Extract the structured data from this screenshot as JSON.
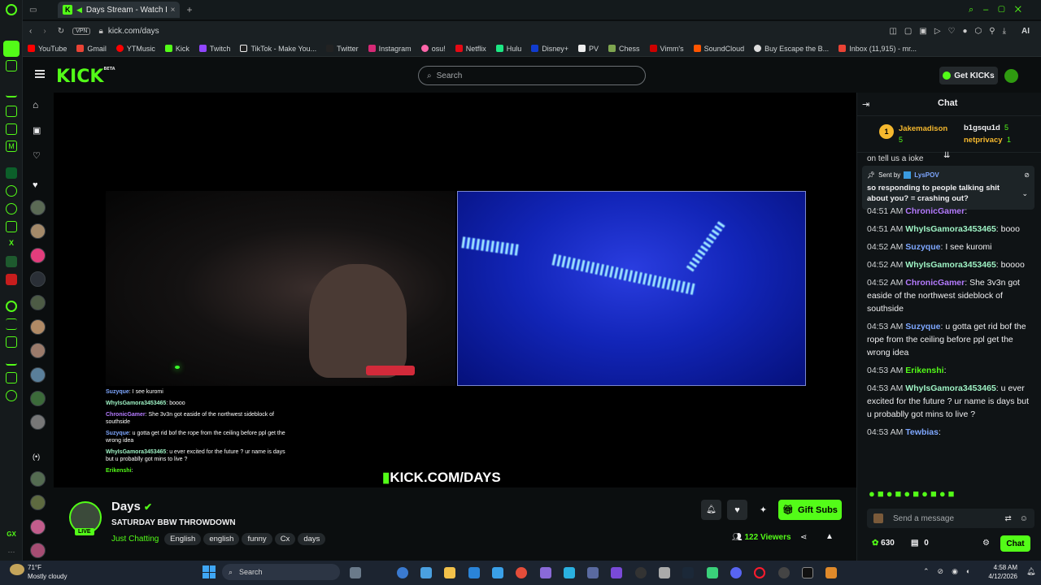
{
  "browser": {
    "tab_title": "Days Stream - Watch L",
    "url": "kick.com/days",
    "vpn_label": "VPN",
    "ai_label": "AI",
    "bookmarks": [
      "YouTube",
      "Gmail",
      "YTMusic",
      "Kick",
      "Twitch",
      "TikTok - Make You...",
      "Twitter",
      "Instagram",
      "osu!",
      "Netflix",
      "Hulu",
      "Disney+",
      "PV",
      "Chess",
      "Vimm's",
      "SoundCloud",
      "Buy Escape the B...",
      "Inbox (11,915) - mr..."
    ]
  },
  "kick": {
    "logo": "KICK",
    "beta": "BETA",
    "search_placeholder": "Search",
    "get_kicks_label": "Get KICKs"
  },
  "video": {
    "watermark": "KICK.COM/DAYS",
    "overlay_chat": [
      {
        "user": "Suzyque",
        "text": ": I see kuromi"
      },
      {
        "user": "WhyIsGamora3453465",
        "text": ": boooo"
      },
      {
        "user": "ChronicGamer",
        "text": ": She 3v3n got easide of the northwest sideblock of southside"
      },
      {
        "user": "Suzyque",
        "text": ": u gotta get rid bof the rope from the ceiling before ppl get the wrong idea"
      },
      {
        "user": "WhyIsGamora3453465",
        "text": ": u ever excited for the future ? ur name is days but u probablly got mins to live ?"
      },
      {
        "user": "Erikenshi",
        "text": ":"
      }
    ]
  },
  "stream": {
    "channel_name": "Days",
    "live_badge": "LIVE",
    "title": "SATURDAY BBW THROWDOWN",
    "category": "Just Chatting",
    "tags": [
      "English",
      "english",
      "funny",
      "Cx",
      "days"
    ],
    "viewers": "122",
    "viewers_label": "Viewers",
    "gift_subs_label": "Gift Subs"
  },
  "chat": {
    "header": "Chat",
    "top_gifters": [
      {
        "rank": "1",
        "name": "Jakemadison",
        "count": "5"
      },
      {
        "name": "b1gsqu1d",
        "count": "5"
      },
      {
        "name": "netprivacy",
        "count": "1"
      }
    ],
    "partial_line": "on tell us a joke",
    "pinned": {
      "sent_by": "Sent by",
      "user": "LysPOV",
      "text": "so responding to people talking shit about you? = crashing out?"
    },
    "messages": [
      {
        "time": "04:51 AM",
        "user": "ChronicGamer",
        "text": ":",
        "color": "#b57bff"
      },
      {
        "time": "04:51 AM",
        "user": "WhyIsGamora3453465",
        "text": ": booo",
        "color": "#9ef2c4"
      },
      {
        "time": "04:52 AM",
        "user": "Suzyque",
        "text": ": I see kuromi",
        "color": "#7ea7ff"
      },
      {
        "time": "04:52 AM",
        "user": "WhyIsGamora3453465",
        "text": ": boooo",
        "color": "#9ef2c4"
      },
      {
        "time": "04:52 AM",
        "user": "ChronicGamer",
        "text": ": She 3v3n got easide of the northwest sideblock of southside",
        "color": "#b57bff"
      },
      {
        "time": "04:53 AM",
        "user": "Suzyque",
        "text": ": u gotta get rid bof the rope from the ceiling before ppl get the wrong idea",
        "color": "#7ea7ff"
      },
      {
        "time": "04:53 AM",
        "user": "Erikenshi",
        "text": ":",
        "color": "#53fc18"
      },
      {
        "time": "04:53 AM",
        "user": "WhyIsGamora3453465",
        "text": ": u ever excited for the future ? ur name is days but u probablly got mins to live ?",
        "color": "#9ef2c4"
      },
      {
        "time": "04:53 AM",
        "user": "Tewbias",
        "text": ":",
        "color": "#7ea7ff"
      }
    ],
    "input_placeholder": "Send a message",
    "points": "630",
    "zero_count": "0",
    "chat_button": "Chat"
  },
  "taskbar": {
    "weather_temp": "71°F",
    "weather_desc": "Mostly cloudy",
    "search_label": "Search",
    "time": "4:58 AM",
    "date": "4/12/2026"
  },
  "colors": {
    "accent": "#53fc18",
    "bg": "#0b0e0f"
  }
}
